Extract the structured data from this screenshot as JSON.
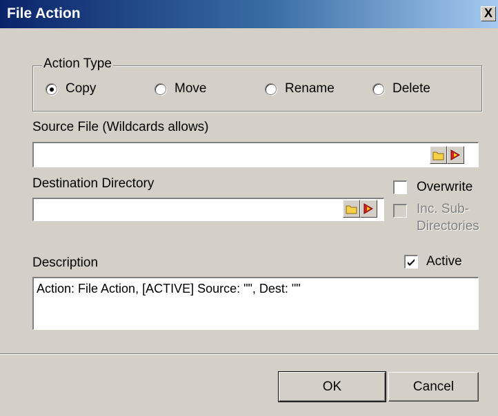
{
  "window": {
    "title": "File Action",
    "close_label": "X"
  },
  "action_type": {
    "label": "Action Type",
    "options": [
      {
        "label": "Copy",
        "selected": true
      },
      {
        "label": "Move",
        "selected": false
      },
      {
        "label": "Rename",
        "selected": false
      },
      {
        "label": "Delete",
        "selected": false
      }
    ]
  },
  "source": {
    "label": "Source File (Wildcards allows)",
    "value": ""
  },
  "destination": {
    "label": "Destination Directory",
    "value": ""
  },
  "overwrite": {
    "label": "Overwrite",
    "checked": false
  },
  "inc_sub": {
    "label_line1": "Inc. Sub-",
    "label_line2": "Directories",
    "checked": false,
    "enabled": false
  },
  "description": {
    "label": "Description",
    "value": "Action: File Action, [ACTIVE] Source: \"\", Dest: \"\""
  },
  "active": {
    "label": "Active",
    "checked": true
  },
  "buttons": {
    "ok": "OK",
    "cancel": "Cancel"
  },
  "icons": {
    "browse": "folder-icon",
    "variable": "pencil-arrow-icon"
  }
}
